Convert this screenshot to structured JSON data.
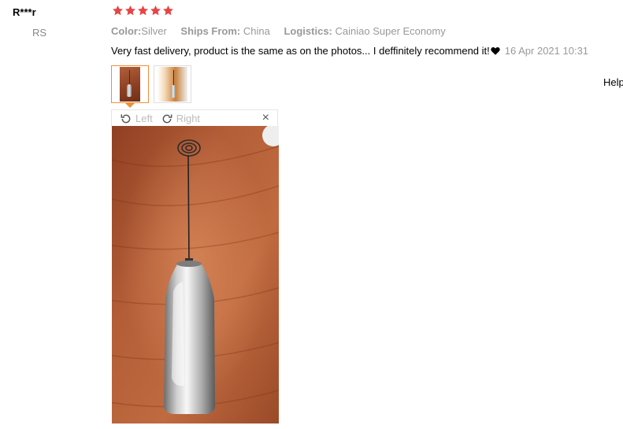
{
  "user": {
    "name": "R***r",
    "country": "RS"
  },
  "review": {
    "rating": 5,
    "star_color": "#e64545",
    "attributes": [
      {
        "key": "Color:",
        "value": "Silver"
      },
      {
        "key": "Ships From:",
        "value": "China"
      },
      {
        "key": "Logistics:",
        "value": "Cainiao Super Economy"
      }
    ],
    "text": "Very fast delivery, product is the same as on the photos... I deffinitely recommend it!",
    "date": "16 Apr 2021 10:31",
    "helpful_label": "Help"
  },
  "thumbnails": [
    {
      "icon": "photo-frother-wood-bg",
      "active": true
    },
    {
      "icon": "photo-frother-light-bg",
      "active": false
    }
  ],
  "viewer": {
    "rotate_left_label": "Left",
    "rotate_right_label": "Right",
    "close_glyph": "×",
    "accent_color": "#f08f3a"
  }
}
